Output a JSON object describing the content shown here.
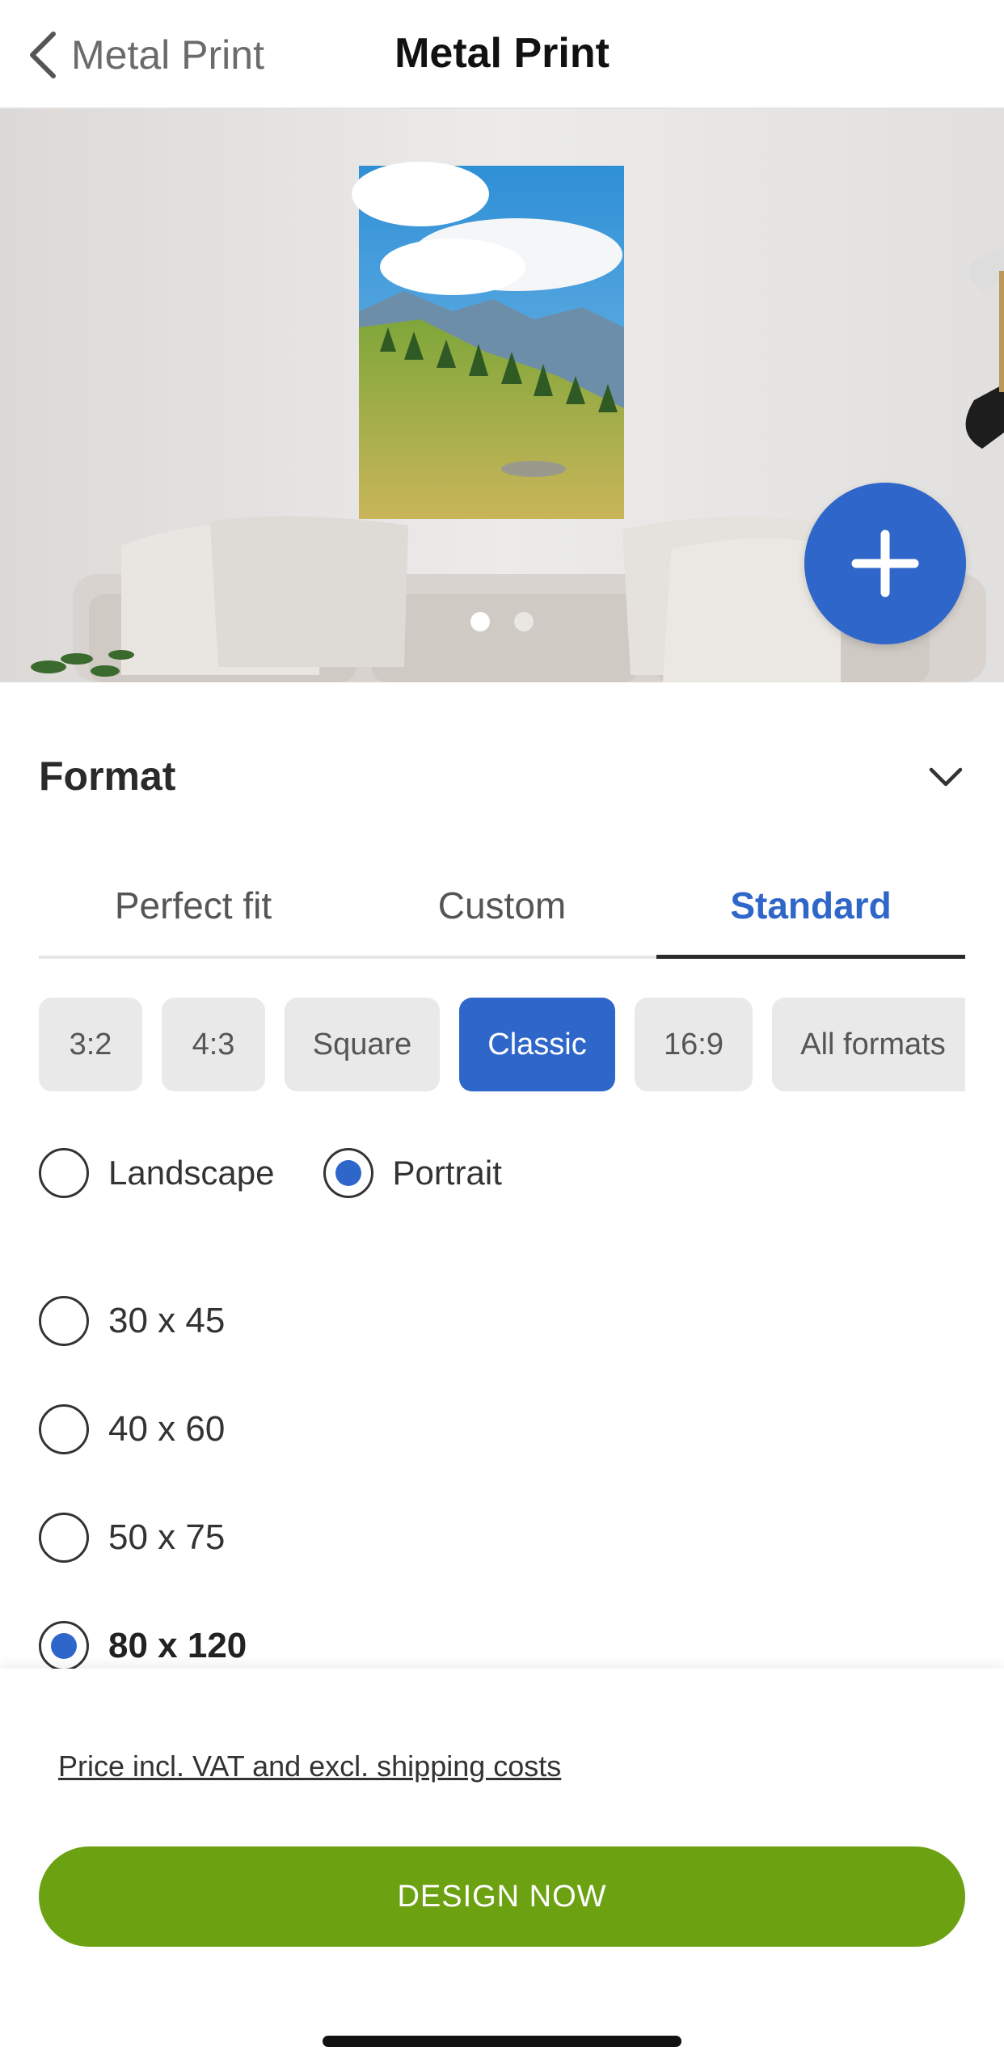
{
  "nav": {
    "back_label": "Metal Print",
    "title": "Metal Print"
  },
  "hero": {
    "carousel_pages": 2,
    "carousel_active": 1
  },
  "format": {
    "title": "Format",
    "tabs": [
      {
        "label": "Perfect fit",
        "active": false
      },
      {
        "label": "Custom",
        "active": false
      },
      {
        "label": "Standard",
        "active": true
      }
    ],
    "ratios": [
      {
        "label": "3:2",
        "active": false
      },
      {
        "label": "4:3",
        "active": false
      },
      {
        "label": "Square",
        "active": false
      },
      {
        "label": "Classic",
        "active": true
      },
      {
        "label": "16:9",
        "active": false
      },
      {
        "label": "All formats",
        "active": false
      }
    ],
    "orientation": [
      {
        "label": "Landscape",
        "selected": false
      },
      {
        "label": "Portrait",
        "selected": true
      }
    ],
    "sizes": [
      {
        "label": "30 x 45",
        "selected": false
      },
      {
        "label": "40 x 60",
        "selected": false
      },
      {
        "label": "50 x 75",
        "selected": false
      },
      {
        "label": "80 x 120",
        "selected": true
      }
    ]
  },
  "footer": {
    "price_note": "Price incl. VAT and excl. shipping costs",
    "cta_label": "DESIGN NOW"
  },
  "colors": {
    "accent_blue": "#2f66c9",
    "cta_green": "#6ca112"
  }
}
